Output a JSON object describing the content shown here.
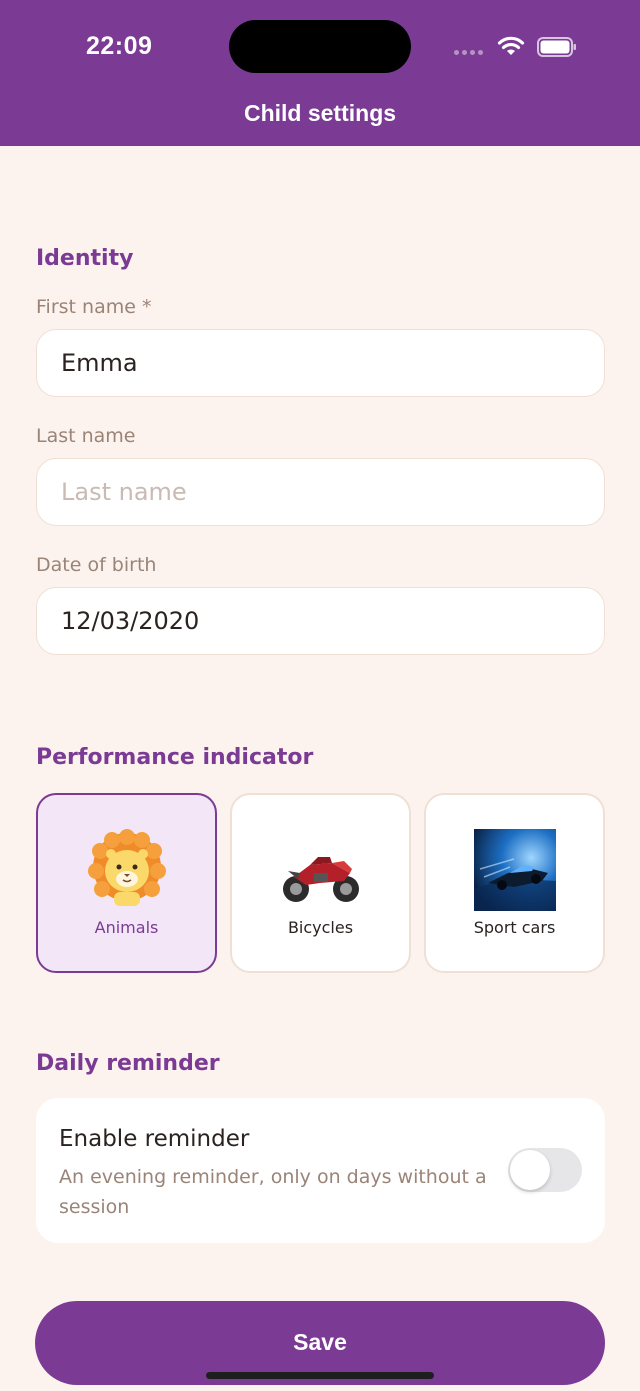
{
  "status_bar": {
    "time": "22:09"
  },
  "header": {
    "title": "Child settings"
  },
  "identity": {
    "section_title": "Identity",
    "first_name": {
      "label": "First name *",
      "value": "Emma"
    },
    "last_name": {
      "label": "Last name",
      "placeholder": "Last name",
      "value": ""
    },
    "date_of_birth": {
      "label": "Date of birth",
      "value": "12/03/2020"
    }
  },
  "performance": {
    "section_title": "Performance indicator",
    "options": [
      {
        "label": "Animals",
        "icon": "lion-icon",
        "selected": true
      },
      {
        "label": "Bicycles",
        "icon": "motorcycle-icon",
        "selected": false
      },
      {
        "label": "Sport cars",
        "icon": "sport-car-icon",
        "selected": false
      }
    ]
  },
  "reminder": {
    "section_title": "Daily reminder",
    "title": "Enable reminder",
    "description": "An evening reminder, only on days without a session",
    "enabled": false
  },
  "actions": {
    "save_label": "Save"
  },
  "colors": {
    "brand": "#7b3b94",
    "background": "#fdf3ee",
    "selected_card": "#f3e6f7"
  }
}
